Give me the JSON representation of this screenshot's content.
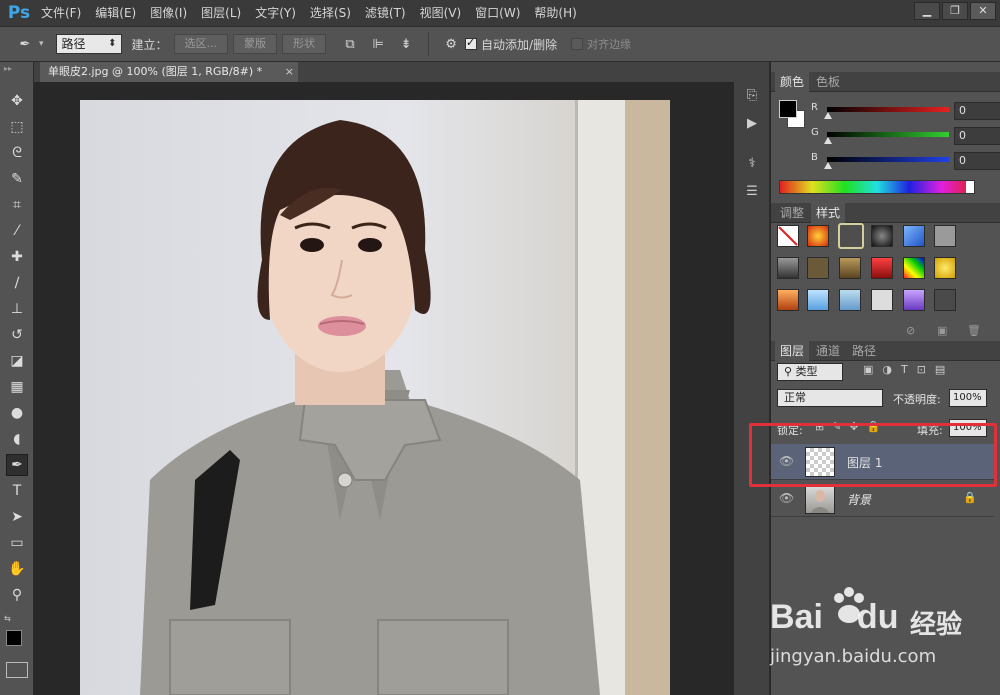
{
  "app": {
    "logo": "Ps",
    "menus": [
      "文件(F)",
      "编辑(E)",
      "图像(I)",
      "图层(L)",
      "文字(Y)",
      "选择(S)",
      "滤镜(T)",
      "视图(V)",
      "窗口(W)",
      "帮助(H)"
    ],
    "window_controls": [
      "▁",
      "❐",
      "✕"
    ]
  },
  "options": {
    "mode_select": "路径",
    "make_label": "建立：",
    "btn_selection": "选区...",
    "btn_mask": "蒙版",
    "btn_shape": "形状",
    "auto_add_label": "自动添加/删除",
    "auto_add_checked": true,
    "align_edges_label": "对齐边缘",
    "align_edges_checked": false
  },
  "document": {
    "tab_title": "单眼皮2.jpg @ 100% (图层 1, RGB/8#) *",
    "close": "×"
  },
  "color_panel": {
    "tabs": [
      "颜色",
      "色板"
    ],
    "active_tab": 0,
    "channels": [
      {
        "label": "R",
        "value": "0",
        "color": "#d22828"
      },
      {
        "label": "G",
        "value": "0",
        "color": "#35b335"
      },
      {
        "label": "B",
        "value": "0",
        "color": "#2c49d6"
      }
    ]
  },
  "styles_panel": {
    "tabs": [
      "调整",
      "样式"
    ],
    "active_tab": 1
  },
  "layers_panel": {
    "tabs": [
      "图层",
      "通道",
      "路径"
    ],
    "active_tab": 0,
    "filter_kind": "类型",
    "blend_mode": "正常",
    "opacity_label": "不透明度:",
    "opacity_value": "100%",
    "lock_label": "锁定:",
    "fill_label": "填充:",
    "fill_value": "100%",
    "layers": [
      {
        "name": "图层 1",
        "selected": true
      },
      {
        "name": "背景",
        "selected": false,
        "locked": true
      }
    ]
  },
  "watermark": {
    "brand": "Bai",
    "brand_tail": "du",
    "cn": "经验",
    "url": "jingyan.baidu.com"
  }
}
